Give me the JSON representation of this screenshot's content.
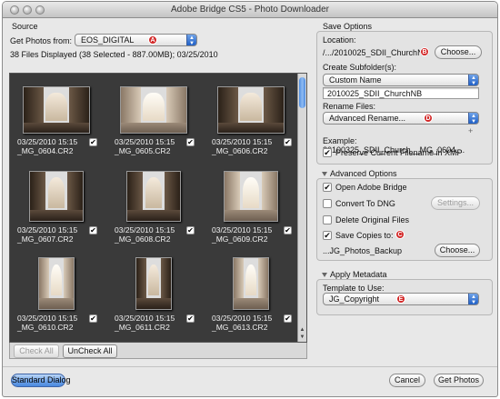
{
  "window": {
    "title": "Adobe Bridge CS5 - Photo Downloader"
  },
  "source": {
    "heading": "Source",
    "get_photos_label": "Get Photos from:",
    "device": "EOS_DIGITAL",
    "badge": "A",
    "summary": "38 Files Displayed (38 Selected - 887.00MB); 03/25/2010"
  },
  "thumbnails": [
    {
      "date": "03/25/2010 15:15",
      "file": "_MG_0604.CR2",
      "checked": "✔",
      "tone": "dark"
    },
    {
      "date": "03/25/2010 15:15",
      "file": "_MG_0605.CR2",
      "checked": "✔",
      "tone": "light"
    },
    {
      "date": "03/25/2010 15:15",
      "file": "_MG_0606.CR2",
      "checked": "✔",
      "tone": "dark"
    },
    {
      "date": "03/25/2010 15:15",
      "file": "_MG_0607.CR2",
      "checked": "✔",
      "tone": "dark"
    },
    {
      "date": "03/25/2010 15:15",
      "file": "_MG_0608.CR2",
      "checked": "✔",
      "tone": "dark"
    },
    {
      "date": "03/25/2010 15:15",
      "file": "_MG_0609.CR2",
      "checked": "✔",
      "tone": "light"
    },
    {
      "date": "03/25/2010 15:15",
      "file": "_MG_0610.CR2",
      "checked": "✔",
      "tone": "light"
    },
    {
      "date": "03/25/2010 15:15",
      "file": "_MG_0611.CR2",
      "checked": "✔",
      "tone": "dark"
    },
    {
      "date": "03/25/2010 15:15",
      "file": "_MG_0613.CR2",
      "checked": "✔",
      "tone": "light"
    }
  ],
  "grid_buttons": {
    "check_all": "Check All",
    "uncheck_all": "UnCheck All"
  },
  "save_options": {
    "heading": "Save Options",
    "location_label": "Location:",
    "location_value": "/.../2010025_SDII_ChurchNB",
    "badge_b": "B",
    "choose_label": "Choose...",
    "subfolder_label": "Create Subfolder(s):",
    "subfolder_value": "Custom Name",
    "subfolder_name": "2010025_SDII_ChurchNB",
    "rename_label": "Rename Files:",
    "rename_value": "Advanced Rename...",
    "badge_d": "D",
    "plus": "+",
    "example_text": "Example:  20100325_SDII_Church__MG_0604....",
    "preserve_label": "Preserve Current Filename in XMP",
    "preserve_checked": "✔"
  },
  "advanced_options": {
    "heading": "Advanced Options",
    "open_bridge": "Open Adobe Bridge",
    "open_bridge_checked": "✔",
    "convert_dng": "Convert To DNG",
    "convert_dng_checked": "",
    "settings_label": "Settings...",
    "delete_originals": "Delete Original Files",
    "delete_originals_checked": "",
    "save_copies": "Save Copies to:",
    "save_copies_checked": "✔",
    "badge_c": "C",
    "copies_path": "...JG_Photos_Backup",
    "choose_label": "Choose..."
  },
  "apply_metadata": {
    "heading": "Apply Metadata",
    "template_label": "Template to Use:",
    "template_value": "JG_Copyright",
    "badge_e": "E"
  },
  "footer": {
    "standard_dialog": "Standard Dialog",
    "cancel": "Cancel",
    "get_photos": "Get Photos"
  }
}
